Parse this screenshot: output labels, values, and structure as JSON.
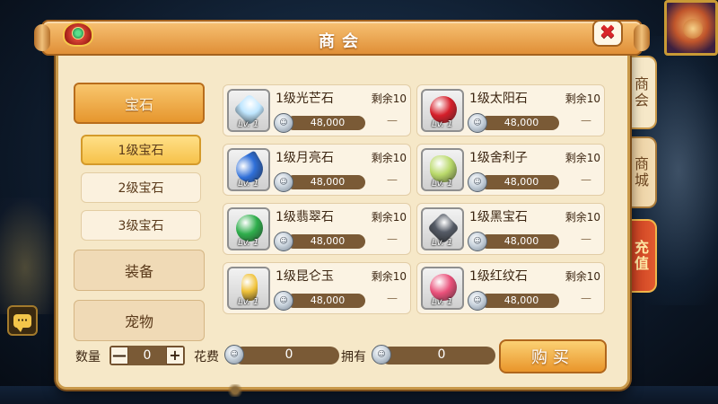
{
  "title": "商会",
  "side_tabs": [
    {
      "label": "商会",
      "active": true
    },
    {
      "label": "商城",
      "active": false
    },
    {
      "label": "充值",
      "active": false
    }
  ],
  "categories": [
    {
      "label": "宝石",
      "selected": true
    },
    {
      "label": "装备",
      "selected": false
    },
    {
      "label": "宠物",
      "selected": false
    }
  ],
  "sub_categories": [
    {
      "label": "1级宝石",
      "selected": true
    },
    {
      "label": "2级宝石",
      "selected": false
    },
    {
      "label": "3级宝石",
      "selected": false
    }
  ],
  "items": [
    {
      "name": "1级光芒石",
      "price": "48,000",
      "remain": "剩余10",
      "owned": "—",
      "level": "Lv. 1",
      "gem": "crystal-gem-icon",
      "color": "#bfe6ff"
    },
    {
      "name": "1级太阳石",
      "price": "48,000",
      "remain": "剩余10",
      "owned": "—",
      "level": "Lv. 1",
      "gem": "sun-gem-icon",
      "color": "#d61f2a"
    },
    {
      "name": "1级月亮石",
      "price": "48,000",
      "remain": "剩余10",
      "owned": "—",
      "level": "Lv. 1",
      "gem": "moon-gem-icon",
      "color": "#2f6fd8"
    },
    {
      "name": "1级舍利子",
      "price": "48,000",
      "remain": "剩余10",
      "owned": "—",
      "level": "Lv. 1",
      "gem": "relic-beads-icon",
      "color": "#b9d96a"
    },
    {
      "name": "1级翡翠石",
      "price": "48,000",
      "remain": "剩余10",
      "owned": "—",
      "level": "Lv. 1",
      "gem": "jade-gem-icon",
      "color": "#2fae4c"
    },
    {
      "name": "1级黑宝石",
      "price": "48,000",
      "remain": "剩余10",
      "owned": "—",
      "level": "Lv. 1",
      "gem": "black-gem-icon",
      "color": "#555b66"
    },
    {
      "name": "1级昆仑玉",
      "price": "48,000",
      "remain": "剩余10",
      "owned": "—",
      "level": "Lv. 1",
      "gem": "kunlun-jade-icon",
      "color": "#f0c23a"
    },
    {
      "name": "1级红纹石",
      "price": "48,000",
      "remain": "剩余10",
      "owned": "—",
      "level": "Lv. 1",
      "gem": "red-pattern-gem-icon",
      "color": "#e9507a"
    }
  ],
  "bottom": {
    "qty_label": "数量",
    "qty_value": "0",
    "minus": "—",
    "plus": "+",
    "cost_label": "花费",
    "cost_value": "0",
    "own_label": "拥有",
    "own_value": "0",
    "buy_label": "购买"
  },
  "colors": {
    "panel": "#f6e8c8",
    "accent": "#e6962e",
    "price_bar": "#7a5a36",
    "close": "#d9262a"
  }
}
